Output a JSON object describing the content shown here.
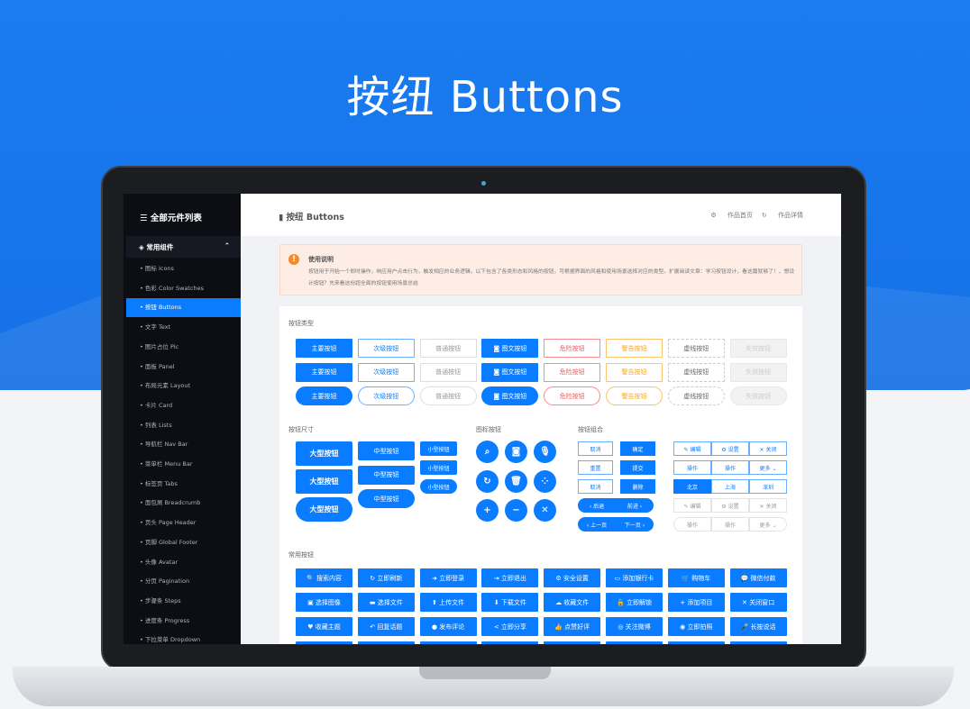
{
  "hero_title": "按纽 Buttons",
  "sidebar": {
    "title": "全部元件列表",
    "group": "常用组件",
    "items": [
      "图标 Icons",
      "色彩 Color Swatches",
      "按钮 Buttons",
      "文字 Text",
      "图片占位 Pic",
      "面板 Panel",
      "布局元素 Layout",
      "卡片 Card",
      "列表 Lists",
      "导航栏 Nav Bar",
      "菜单栏 Menu Bar",
      "标签页 Tabs",
      "面包屑 Breadcrumb",
      "页头 Page Header",
      "页脚 Global Footer",
      "头像 Avatar",
      "分页 Pagination",
      "步骤条 Steps",
      "进度条 Progress",
      "下拉菜单 Dropdown"
    ],
    "active_index": 2
  },
  "header": {
    "title": "按纽 Buttons",
    "links": [
      "作品首页",
      "作品详情"
    ]
  },
  "notice": {
    "title": "使用说明",
    "text": "按钮用于开始一个即时操作，响应用户点击行为，触发相应的业务逻辑。以下包含了各类形态和风格的按钮，可根据界面的风格和使用场景选择对应的类型。扩展阅读文章：学习按钮设计，看这篇就够了！、想设计按钮？先来看这份超全面的按钮使用场景总结"
  },
  "sections": {
    "types": "按钮类型",
    "sizes": "按钮尺寸",
    "icons": "图标按钮",
    "groups": "按钮组合",
    "common": "常用按钮"
  },
  "types": [
    "主要按钮",
    "次级按钮",
    "普通按钮",
    "图文按钮",
    "危险按钮",
    "警告按钮",
    "虚线按钮",
    "失效按钮"
  ],
  "sizes": {
    "large": "大型按钮",
    "medium": "中型按钮",
    "small": "小型按钮"
  },
  "icon_buttons": [
    "search-icon",
    "camera-icon",
    "microphone-icon",
    "refresh-icon",
    "trash-icon",
    "spinner-icon",
    "plus-icon",
    "minus-icon",
    "close-icon"
  ],
  "groups_left": [
    [
      "取消",
      "确定"
    ],
    [
      "重置",
      "提交"
    ],
    [
      "取消",
      "删除"
    ],
    [
      "后退",
      "前进"
    ],
    [
      "上一页",
      "下一页"
    ]
  ],
  "groups_right": [
    [
      "编辑",
      "设置",
      "关闭"
    ],
    [
      "操作",
      "操作",
      "更多"
    ],
    [
      "北京",
      "上海",
      "深圳"
    ],
    [
      "编辑",
      "设置",
      "关闭"
    ],
    [
      "操作",
      "操作",
      "更多"
    ]
  ],
  "common": [
    "搜索内容",
    "立即刷新",
    "立即登录",
    "立即退出",
    "安全设置",
    "添加银行卡",
    "购物车",
    "微信付款",
    "选择图像",
    "选择文件",
    "上传文件",
    "下载文件",
    "收藏文件",
    "立即解锁",
    "添加项目",
    "关闭窗口",
    "收藏主题",
    "回复话题",
    "发布评论",
    "立即分享",
    "点赞好评",
    "关注微博",
    "立即拍照",
    "长按说话",
    "",
    "",
    "",
    "",
    "",
    "",
    "",
    ""
  ],
  "common_icons": [
    "🔍",
    "↻",
    "➜",
    "⇥",
    "⚙",
    "▭",
    "🛒",
    "💬",
    "▣",
    "▬",
    "⬆",
    "⬇",
    "☁",
    "🔓",
    "+",
    "✕",
    "♥",
    "↶",
    "●",
    "<",
    "👍",
    "◎",
    "◉",
    "🎤",
    "",
    "",
    "",
    "",
    "",
    "",
    "",
    ""
  ],
  "colors": {
    "primary": "#0a7cff",
    "danger": "#f25c5c",
    "warning": "#f5a623",
    "sidebar": "#0c0e13"
  }
}
